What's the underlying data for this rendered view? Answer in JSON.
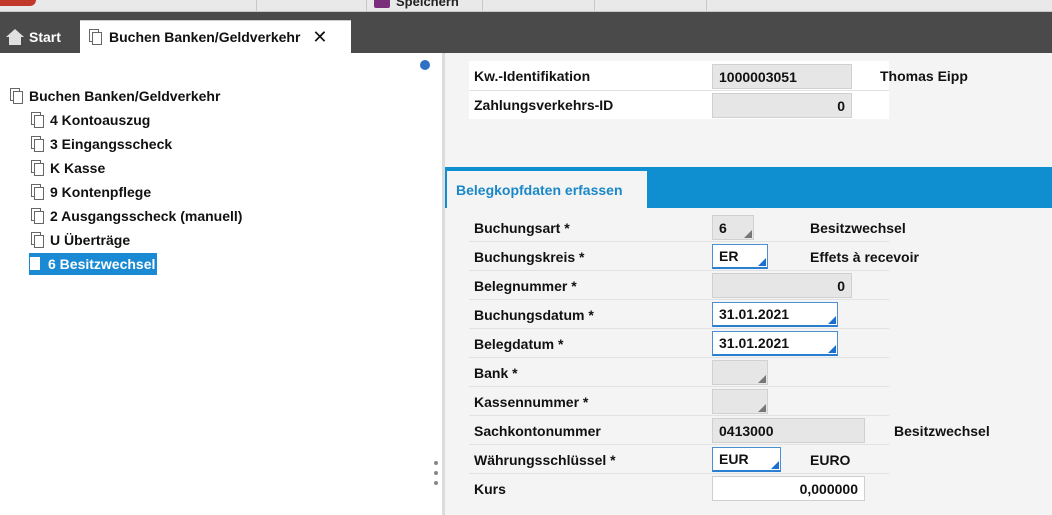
{
  "toolbar": {
    "save_label": "Speichern"
  },
  "tabs": {
    "start_label": "Start",
    "active_label": "Buchen Banken/Geldverkehr",
    "close_symbol": "✕"
  },
  "tree": {
    "root_label": "Buchen Banken/Geldverkehr",
    "items": [
      {
        "label": "4 Kontoauszug"
      },
      {
        "label": "3 Eingangsscheck"
      },
      {
        "label": "K Kasse"
      },
      {
        "label": "9 Kontenpflege"
      },
      {
        "label": "2 Ausgangsscheck (manuell)"
      },
      {
        "label": "U Überträge"
      },
      {
        "label": "6 Besitzwechsel"
      }
    ],
    "selected_index": 6
  },
  "header": {
    "kw_id_label": "Kw.-Identifikation",
    "kw_id_value": "1000003051",
    "kw_name": "Thomas Eipp",
    "zv_id_label": "Zahlungsverkehrs-ID",
    "zv_id_value": "0"
  },
  "section": {
    "title": "Belegkopfdaten erfassen"
  },
  "form": {
    "buchungsart_label": "Buchungsart *",
    "buchungsart_value": "6",
    "buchungsart_desc": "Besitzwechsel",
    "buchungskreis_label": "Buchungskreis *",
    "buchungskreis_value": "ER",
    "buchungskreis_desc": "Effets à recevoir",
    "belegnummer_label": "Belegnummer *",
    "belegnummer_value": "0",
    "buchungsdatum_label": "Buchungsdatum *",
    "buchungsdatum_value": "31.01.2021",
    "belegdatum_label": "Belegdatum *",
    "belegdatum_value": "31.01.2021",
    "bank_label": "Bank *",
    "bank_value": "",
    "kassennummer_label": "Kassennummer *",
    "kassennummer_value": "",
    "sachkonto_label": "Sachkontonummer",
    "sachkonto_value": "0413000",
    "sachkonto_desc": "Besitzwechsel",
    "waehrung_label": "Währungsschlüssel *",
    "waehrung_value": "EUR",
    "waehrung_desc": "EURO",
    "kurs_label": "Kurs",
    "kurs_value": "0,000000"
  },
  "colors": {
    "tabbar": "#4a4a4a",
    "accent_blue": "#0f8fd0",
    "selection_blue": "#1a8ad4",
    "panel_bg": "#f4f4f4"
  }
}
